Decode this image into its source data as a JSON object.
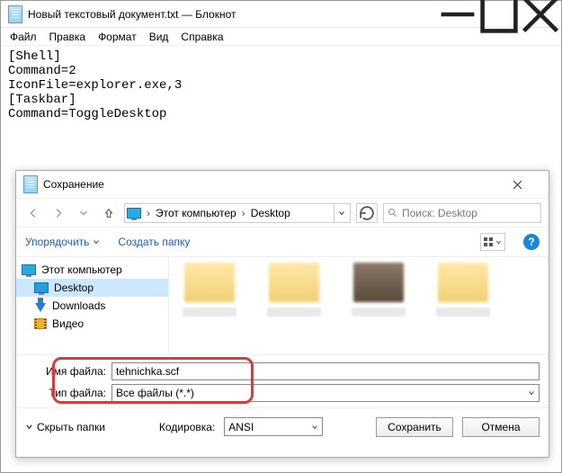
{
  "notepad": {
    "title": "Новый текстовый документ.txt — Блокнот",
    "menu": {
      "file": "Файл",
      "edit": "Правка",
      "format": "Формат",
      "view": "Вид",
      "help": "Справка"
    },
    "content": "[Shell]\nCommand=2\nIconFile=explorer.exe,3\n[Taskbar]\nCommand=ToggleDesktop"
  },
  "dialog": {
    "title": "Сохранение",
    "breadcrumb": {
      "root": "Этот компьютер",
      "leaf": "Desktop"
    },
    "search_placeholder": "Поиск: Desktop",
    "organize": "Упорядочить",
    "new_folder": "Создать папку",
    "tree": {
      "root": "Этот компьютер",
      "desktop": "Desktop",
      "downloads": "Downloads",
      "videos": "Видео"
    },
    "filename_label": "Имя файла:",
    "filename_value": "tehnichka.scf",
    "filetype_label": "Тип файла:",
    "filetype_value": "Все файлы  (*.*)",
    "hide_folders": "Скрыть папки",
    "encoding_label": "Кодировка:",
    "encoding_value": "ANSI",
    "save": "Сохранить",
    "cancel": "Отмена"
  }
}
